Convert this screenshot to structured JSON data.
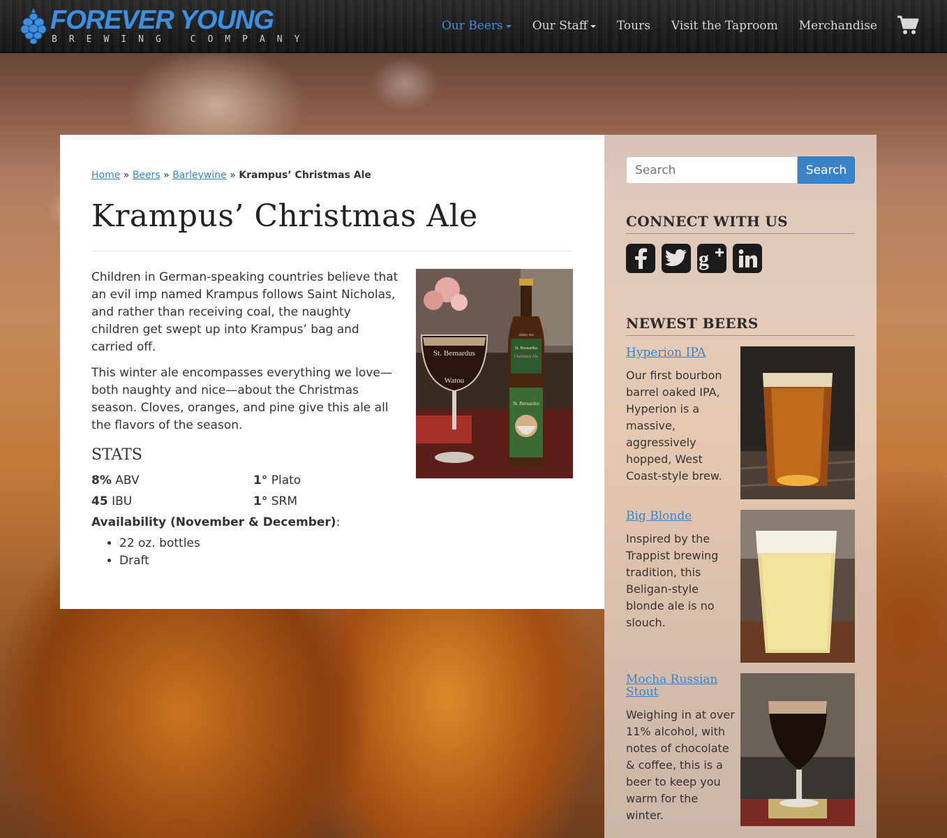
{
  "brand": {
    "name": "FOREVER YOUNG",
    "sub": "BREWING COMPANY"
  },
  "nav": {
    "items": [
      {
        "label": "Our Beers",
        "dropdown": true,
        "active": true
      },
      {
        "label": "Our Staff",
        "dropdown": true,
        "active": false
      },
      {
        "label": "Tours",
        "dropdown": false,
        "active": false
      },
      {
        "label": "Visit the Taproom",
        "dropdown": false,
        "active": false
      },
      {
        "label": "Merchandise",
        "dropdown": false,
        "active": false
      }
    ],
    "cart_icon": "shopping-cart-icon"
  },
  "breadcrumb": {
    "items": [
      "Home",
      "Beers",
      "Barleywine"
    ],
    "separator": "»",
    "current": "Krampus’ Christmas Ale"
  },
  "page": {
    "title": "Krampus’ Christmas Ale",
    "paragraphs": [
      "Children in German-speaking countries believe that an evil imp named Krampus follows Saint Nicholas, and rather than receiving coal, the naughty children get swept up into Krampus’ bag and carried off.",
      "This winter ale encompasses everything we love—both naughty and nice—about the Christmas season. Cloves, oranges, and pine give this ale all the flavors of the season."
    ],
    "stats_heading": "STATS",
    "stats": [
      {
        "value": "8%",
        "unit": " ABV"
      },
      {
        "value": "1°",
        "unit": " Plato"
      },
      {
        "value": "45",
        "unit": " IBU"
      },
      {
        "value": "1°",
        "unit": " SRM"
      }
    ],
    "availability_label": "Availability (November & December)",
    "availability": [
      "22 oz. bottles",
      "Draft"
    ],
    "photo_text": {
      "glass_brand": "St. Bernardus",
      "glass_city": "Watou",
      "bottle_label": "St. Bernardus",
      "bottle_sub": "Christmas Ale",
      "bottle_top": "Abbey Ale"
    }
  },
  "sidebar": {
    "search": {
      "placeholder": "Search",
      "button": "Search"
    },
    "connect_heading": "CONNECT WITH US",
    "social": [
      {
        "icon": "facebook-icon",
        "glyph": "f"
      },
      {
        "icon": "twitter-icon",
        "glyph": "🐦"
      },
      {
        "icon": "google-plus-icon",
        "glyph": "g+"
      },
      {
        "icon": "linkedin-icon",
        "glyph": "in"
      }
    ],
    "newest_heading": "NEWEST BEERS",
    "beers": [
      {
        "name": "Hyperion IPA",
        "desc": "Our first bourbon barrel oaked IPA, Hyperion is a massive, aggressively hopped, West Coast-style brew."
      },
      {
        "name": "Big Blonde",
        "desc": "Inspired by the Trappist brewing tradition, this Beligan-style blonde ale is no slouch."
      },
      {
        "name": "Mocha Russian Stout",
        "desc": "Weighing in at over 11% alcohol, with notes of chocolate & coffee, this is a beer to keep you warm for the winter."
      }
    ]
  },
  "colors": {
    "accent": "#3b83c9",
    "brand_blue": "#3f8fe0",
    "nav_bg": "#1c1c1c"
  }
}
